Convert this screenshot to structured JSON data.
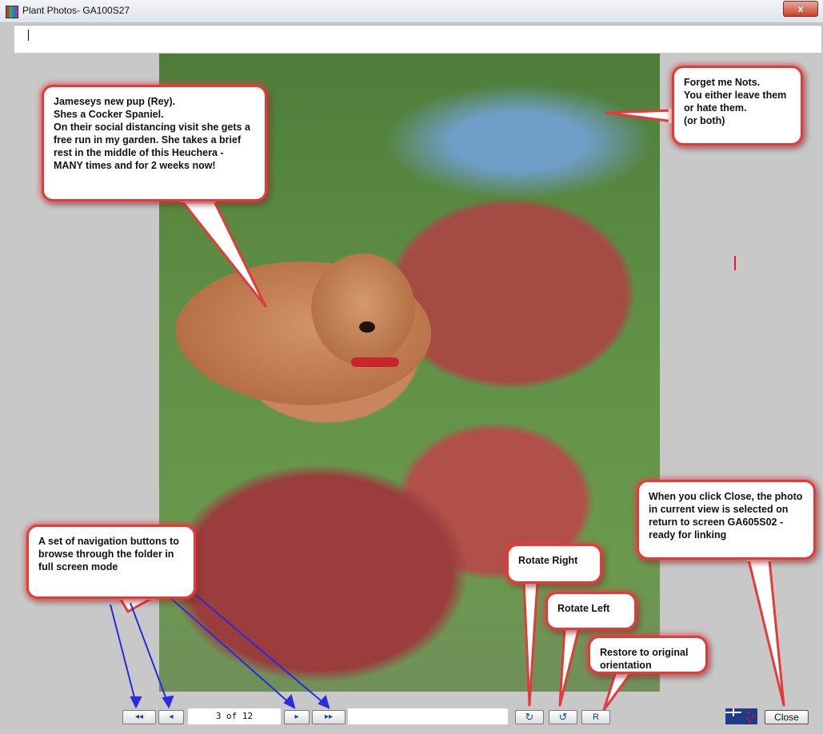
{
  "window": {
    "title": "Plant Photos- GA100S27",
    "close_label": "x"
  },
  "photo": {
    "subject": ""
  },
  "callouts": {
    "pup": "Jameseys new pup (Rey).\nShes a Cocker Spaniel.\nOn their social distancing visit she gets a free run in my garden.  She takes a brief rest in the middle of this Heuchera - MANY times and for 2 weeks now!",
    "forget_me_nots": "Forget me Nots.\nYou either leave them or hate them.\n(or both)",
    "close_info": "When you click Close, the photo in current view is selected on return to screen GA605S02 - ready for linking",
    "navigation": "A set of navigation buttons to browse through the folder in full screen mode",
    "rotate_right": "Rotate Right",
    "rotate_left": "Rotate Left",
    "restore": "Restore to original orientation"
  },
  "toolbar": {
    "first_label": "◂◂",
    "prev_label": "◂",
    "counter": "3 of 12",
    "next_label": "▸",
    "last_label": "▸▸",
    "rotate_right_symbol": "↻",
    "rotate_left_symbol": "↺",
    "restore_label": "R",
    "close_label": "Close"
  },
  "colors": {
    "callout_border": "#e43a3a",
    "arrow_blue": "#2a2ae0",
    "accent_red": "#e43a3a"
  }
}
